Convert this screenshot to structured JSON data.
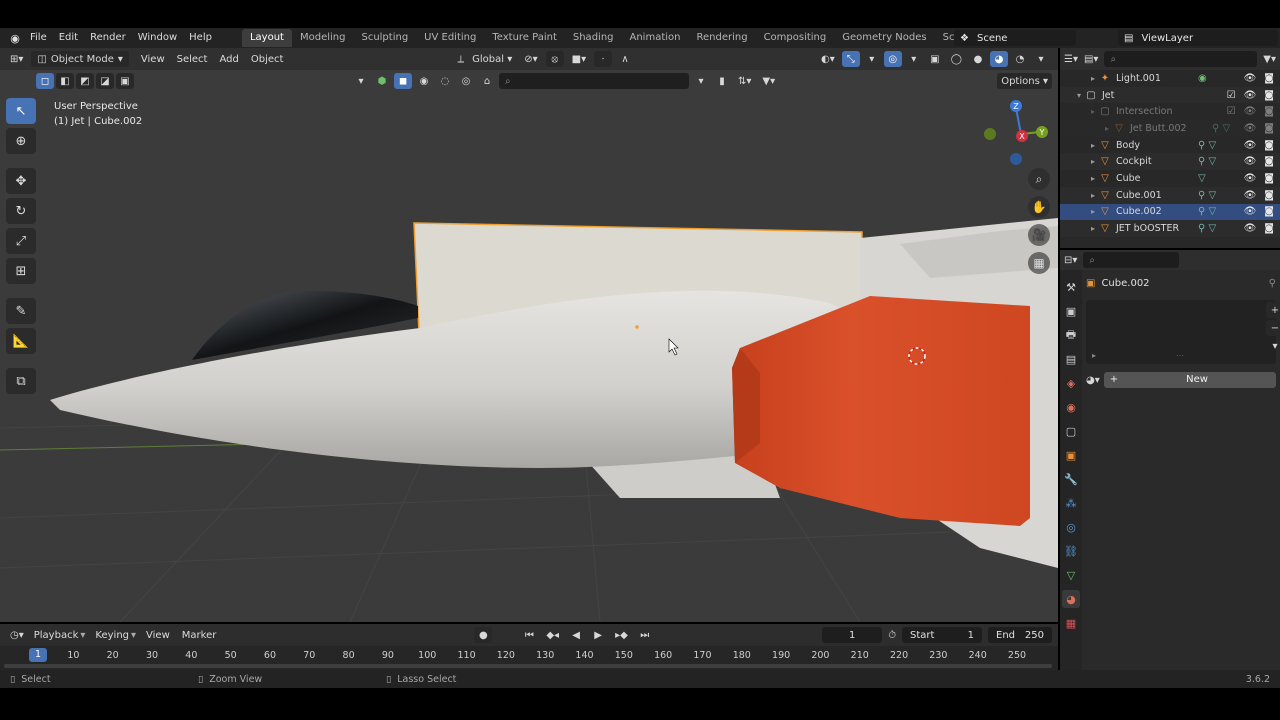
{
  "menubar": {
    "items": [
      "File",
      "Edit",
      "Render",
      "Window",
      "Help"
    ],
    "workspaces": [
      "Layout",
      "Modeling",
      "Sculpting",
      "UV Editing",
      "Texture Paint",
      "Shading",
      "Animation",
      "Rendering",
      "Compositing",
      "Geometry Nodes",
      "Scripting"
    ],
    "active_workspace": "Layout",
    "add_tab": "+",
    "scene": "Scene",
    "view_layer": "ViewLayer"
  },
  "viewport": {
    "mode": "Object Mode",
    "menus": [
      "View",
      "Select",
      "Add",
      "Object"
    ],
    "orientation": "Global",
    "options": "Options",
    "view_name": "User Perspective",
    "active_object": "(1) Jet | Cube.002",
    "gizmo": {
      "z": "Z",
      "x": "X",
      "y": "Y"
    }
  },
  "outliner": {
    "rows": [
      {
        "name": "Light.001",
        "type": "light",
        "indent": 2,
        "expander": "▸"
      },
      {
        "name": "Jet",
        "type": "collection",
        "indent": 1,
        "expander": "▾"
      },
      {
        "name": "Intersection",
        "type": "collection",
        "indent": 2,
        "expander": "▸",
        "dim": true
      },
      {
        "name": "Jet Butt.002",
        "type": "mesh",
        "indent": 3,
        "expander": "▸",
        "dim": true
      },
      {
        "name": "Body",
        "type": "mesh",
        "indent": 2,
        "expander": "▸"
      },
      {
        "name": "Cockpit",
        "type": "mesh",
        "indent": 2,
        "expander": "▸"
      },
      {
        "name": "Cube",
        "type": "mesh",
        "indent": 2,
        "expander": "▸"
      },
      {
        "name": "Cube.001",
        "type": "mesh",
        "indent": 2,
        "expander": "▸"
      },
      {
        "name": "Cube.002",
        "type": "mesh",
        "indent": 2,
        "expander": "▸",
        "selected": true
      },
      {
        "name": "JET bOOSTER",
        "type": "mesh",
        "indent": 2,
        "expander": "▸"
      }
    ]
  },
  "properties": {
    "material_object": "Cube.002",
    "new_button": "New"
  },
  "timeline": {
    "menus": [
      "Playback",
      "Keying",
      "View",
      "Marker"
    ],
    "current_frame": "1",
    "start_label": "Start",
    "start": "1",
    "end_label": "End",
    "end": "250",
    "ticks": [
      "1",
      "10",
      "20",
      "30",
      "40",
      "50",
      "60",
      "70",
      "80",
      "90",
      "100",
      "110",
      "120",
      "130",
      "140",
      "150",
      "160",
      "170",
      "180",
      "190",
      "200",
      "210",
      "220",
      "230",
      "240",
      "250"
    ]
  },
  "statusbar": {
    "select": "Select",
    "zoom": "Zoom View",
    "lasso": "Lasso Select",
    "version": "3.6.2"
  },
  "colors": {
    "accent": "#4772b3",
    "object_orange": "#e8913a",
    "booster_red": "#d4451f",
    "selection_outline": "#f0a030"
  }
}
